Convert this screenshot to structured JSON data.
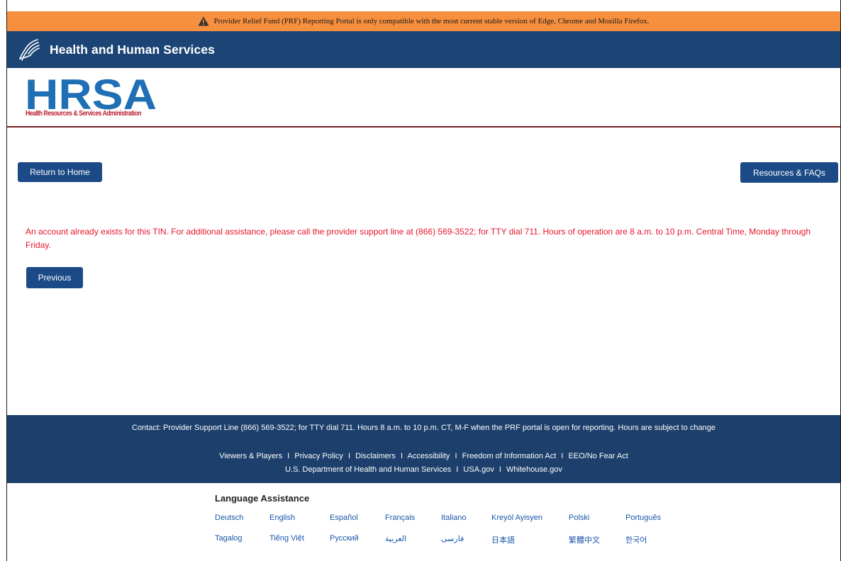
{
  "banner": {
    "warning_text": "Provider Relief Fund (PRF) Reporting Portal is only compatible with the most current stable version of Edge, Chrome and Mozilla Firefox.",
    "icon": "warning-triangle-icon",
    "color": "#f68f3e"
  },
  "header": {
    "title": "Health and Human Services",
    "logo_icon": "hhs-eagle-icon",
    "color": "#1c4576"
  },
  "agency": {
    "logo_text": "HRSA",
    "subtitle": "Health Resources & Services Administration",
    "logo_color": "#1f6fb4"
  },
  "actions": {
    "home_label": "Return to Home",
    "resources_label": "Resources & FAQs",
    "previous_label": "Previous"
  },
  "message": {
    "error_text": "An account already exists for this TIN. For additional assistance, please call the provider support line at (866) 569-3522; for TTY dial 711. Hours of operation are 8 a.m. to 10 p.m. Central Time, Monday through Friday.",
    "color": "#e8142a"
  },
  "footer": {
    "contact": "Contact: Provider Support Line (866) 569-3522; for TTY dial 711. Hours 8 a.m. to 10 p.m. CT, M-F when the PRF portal is open for reporting. Hours are subject to change",
    "links_row1": [
      "Viewers & Players",
      "Privacy Policy",
      "Disclaimers",
      "Accessibility",
      "Freedom of Information Act",
      "EEO/No Fear Act"
    ],
    "links_row2": [
      "U.S. Department of Health and Human Services",
      "USA.gov",
      "Whitehouse.gov"
    ],
    "separator": "I"
  },
  "language": {
    "title": "Language Assistance",
    "row1": [
      "Deutsch",
      "English",
      "Español",
      "Français",
      "Italiano",
      "Kreyòl Ayisyen",
      "Polski",
      "Português"
    ],
    "row2": [
      "Tagalog",
      "Tiếng Việt",
      "Русский",
      "العربية",
      "فارسی",
      "日本語",
      "繁體中文",
      "한국어"
    ]
  }
}
